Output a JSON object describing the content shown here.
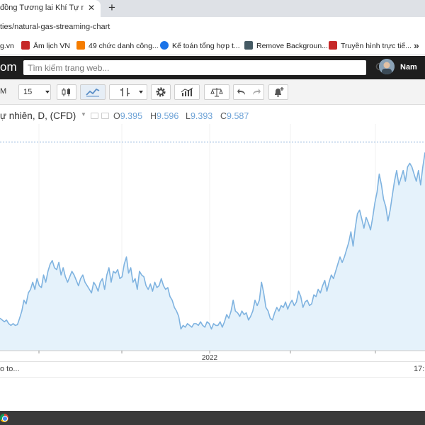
{
  "browser": {
    "tab_title": "đồng Tương lai Khí Tự nhiên",
    "tab_close": "✕",
    "new_tab": "+",
    "url": "ties/natural-gas-streaming-chart"
  },
  "bookmarks": [
    {
      "label": "g.vn",
      "icon_color": "#b23a2a"
    },
    {
      "label": "Âm lịch VN",
      "icon_color": "#c62828"
    },
    {
      "label": "49 chức danh công...",
      "icon_color": "#f57c00"
    },
    {
      "label": "Kế toán tổng hợp t...",
      "icon_color": "#1a73e8"
    },
    {
      "label": "Remove Backgroun...",
      "icon_color": "#455a64"
    },
    {
      "label": "Truyền hình trực tiế...",
      "icon_color": "#c62828"
    }
  ],
  "bookmarks_more": "»",
  "site": {
    "logo_tail": "om",
    "search_placeholder": "Tìm kiếm trang web...",
    "user_name": "Nam"
  },
  "toolbar": {
    "timeframe_letter": "M",
    "interval": "15"
  },
  "legend": {
    "title": "ự nhiên, D, (CFD)",
    "open_label": "O",
    "open_value": "9.395",
    "high_label": "H",
    "high_value": "9.596",
    "low_label": "L",
    "low_value": "9.393",
    "close_label": "C",
    "close_value": "9.587"
  },
  "colors": {
    "line": "#7fb3e0",
    "area": "#e5f2fb",
    "ohlc_value": "#6ba1d6",
    "header_bg": "#1e1e1e"
  },
  "chart_data": {
    "type": "area",
    "x_tick_labels": [
      "2022"
    ],
    "series": [
      {
        "values": [
          6.1,
          6.05,
          6.0,
          6.05,
          5.95,
          5.9,
          5.95,
          5.9,
          5.92,
          6.1,
          6.3,
          6.6,
          6.5,
          6.8,
          6.9,
          7.1,
          6.9,
          7.2,
          7.0,
          6.95,
          7.3,
          7.1,
          7.4,
          7.6,
          7.7,
          7.5,
          7.45,
          7.65,
          7.3,
          7.5,
          7.25,
          7.1,
          7.25,
          7.4,
          7.3,
          7.15,
          7.0,
          7.2,
          7.3,
          7.1,
          7.0,
          6.9,
          6.8,
          7.1,
          7.0,
          6.85,
          7.1,
          7.2,
          6.9,
          7.3,
          7.5,
          7.1,
          7.4,
          7.35,
          7.45,
          7.2,
          7.25,
          7.6,
          7.8,
          7.35,
          7.5,
          7.1,
          7.2,
          6.9,
          7.4,
          7.3,
          7.25,
          7.0,
          6.9,
          7.05,
          6.85,
          7.1,
          6.95,
          7.0,
          7.2,
          7.0,
          6.9,
          6.95,
          6.7,
          6.6,
          6.4,
          6.3,
          6.15,
          5.8,
          5.9,
          5.85,
          5.95,
          5.9,
          5.85,
          5.95,
          5.95,
          5.9,
          6.0,
          5.9,
          5.85,
          6.0,
          5.95,
          5.8,
          5.95,
          5.9,
          5.9,
          6.0,
          5.85,
          6.0,
          6.2,
          6.1,
          6.3,
          6.6,
          6.3,
          6.25,
          6.15,
          6.3,
          6.2,
          6.25,
          6.05,
          6.15,
          6.3,
          6.6,
          6.45,
          6.6,
          7.1,
          6.8,
          6.4,
          6.3,
          6.1,
          6.05,
          6.25,
          6.4,
          6.3,
          6.45,
          6.4,
          6.55,
          6.35,
          6.5,
          6.6,
          6.45,
          6.55,
          6.85,
          6.7,
          6.4,
          6.55,
          6.6,
          6.45,
          6.5,
          6.75,
          6.7,
          6.9,
          6.8,
          7.0,
          7.15,
          6.85,
          7.1,
          7.3,
          7.2,
          7.4,
          7.6,
          7.8,
          7.65,
          7.8,
          8.0,
          8.2,
          8.5,
          8.1,
          8.6,
          9.0,
          9.1,
          8.85,
          8.6,
          8.9,
          8.75,
          8.55,
          8.9,
          9.3,
          9.6,
          10.1,
          9.8,
          9.4,
          9.2,
          8.8,
          9.1,
          9.5,
          9.9,
          10.2,
          9.8,
          10.0,
          10.2,
          9.9,
          10.3,
          10.4,
          10.3,
          10.1,
          9.9,
          10.2,
          9.8,
          10.3,
          10.7
        ],
        "last": 9.587,
        "high": 9.596,
        "low": 9.393,
        "open": 9.395
      }
    ]
  },
  "bottom": {
    "goto_label": "o to...",
    "clock_label": "17:"
  }
}
